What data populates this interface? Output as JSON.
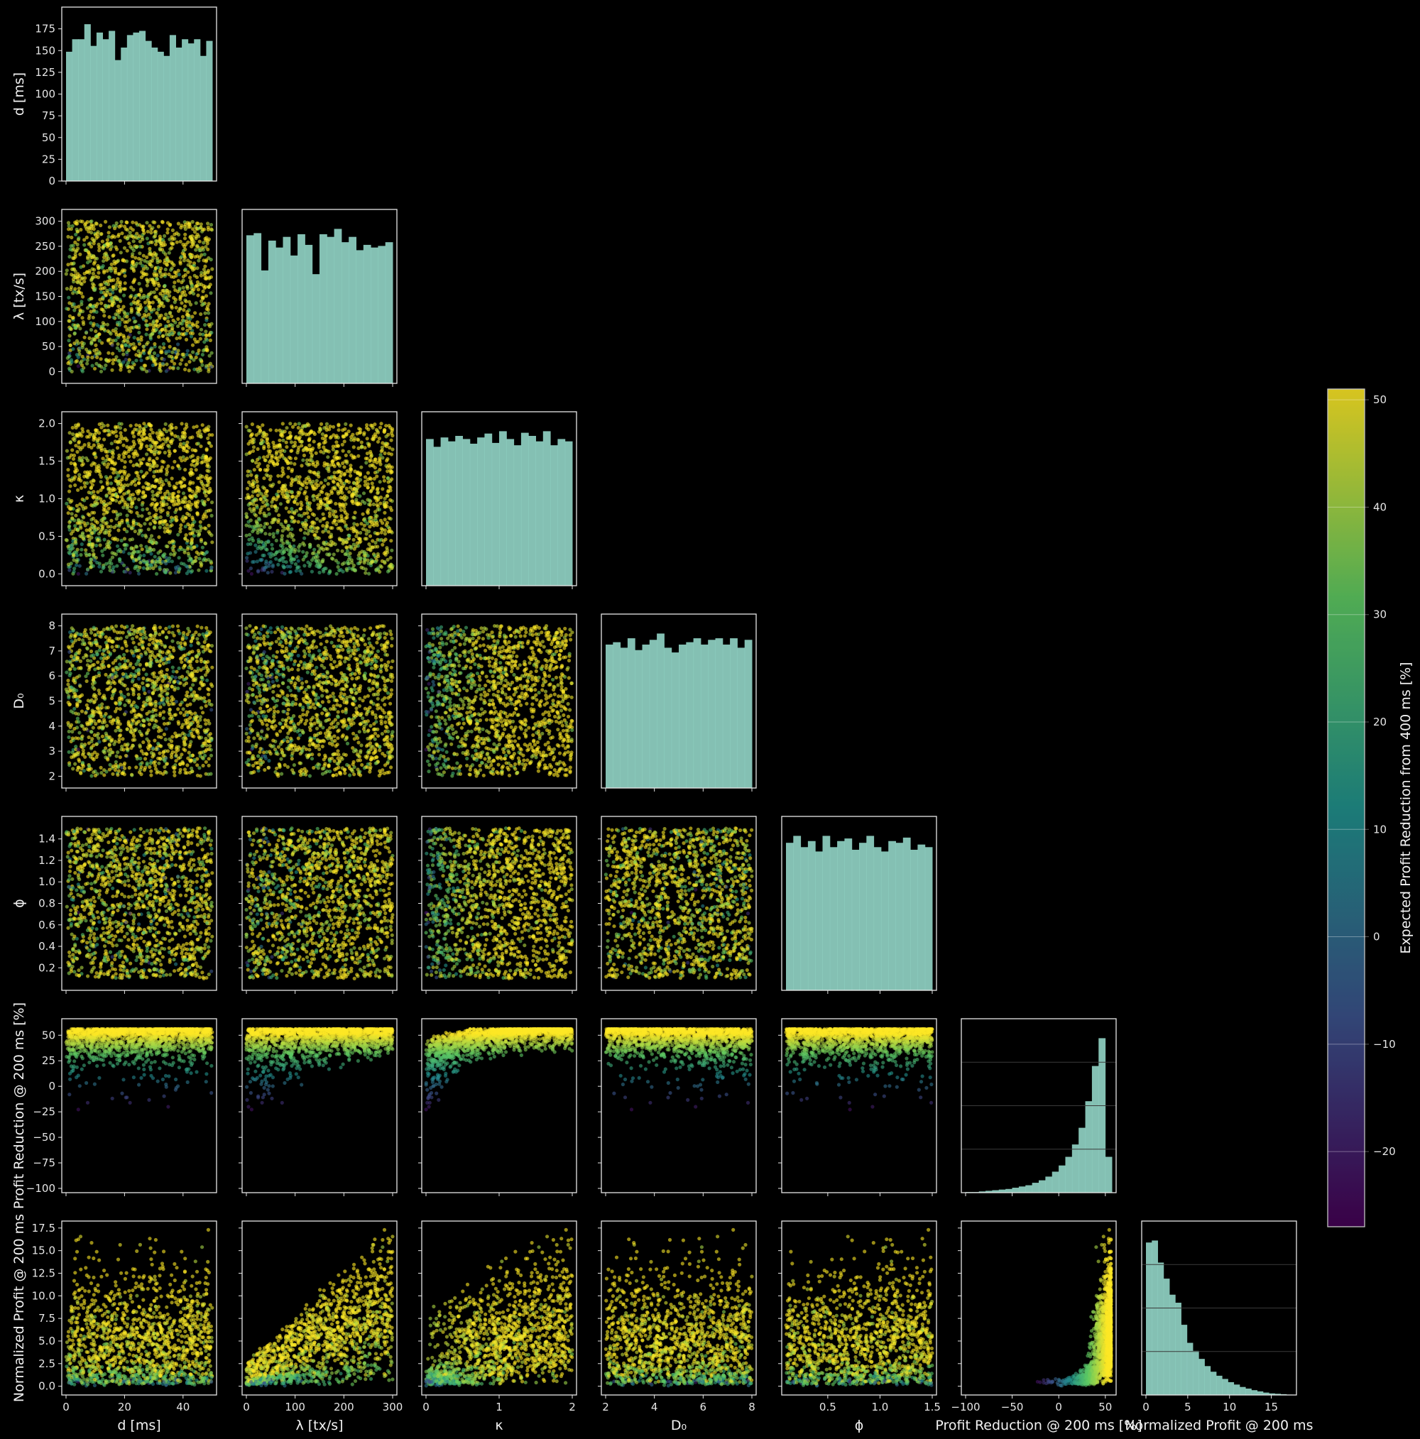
{
  "chart_data": {
    "type": "scatter",
    "variables": [
      {
        "key": "d",
        "label": "d [ms]",
        "range": [
          0,
          50
        ],
        "ylim": [
          0,
          50
        ],
        "ticks": [
          0,
          20,
          40
        ],
        "tick_labels": [
          "0",
          "20",
          "40"
        ]
      },
      {
        "key": "lambda",
        "label": "λ [tx/s]",
        "range": [
          0,
          300
        ],
        "ylim": [
          -15,
          315
        ],
        "ticks": [
          0,
          100,
          200,
          300
        ],
        "tick_labels": [
          "0",
          "100",
          "200",
          "300"
        ],
        "yticks": [
          0,
          50,
          100,
          150,
          200,
          250,
          300
        ],
        "ytick_labels": [
          "0",
          "50",
          "100",
          "150",
          "200",
          "250",
          "300"
        ]
      },
      {
        "key": "kappa",
        "label": "κ",
        "range": [
          0,
          2
        ],
        "ylim": [
          -0.1,
          2.1
        ],
        "ticks": [
          0,
          1,
          2
        ],
        "tick_labels": [
          "0",
          "1",
          "2"
        ],
        "yticks": [
          0,
          0.5,
          1,
          1.5,
          2
        ],
        "ytick_labels": [
          "0.0",
          "0.5",
          "1.0",
          "1.5",
          "2.0"
        ]
      },
      {
        "key": "D0",
        "label": "D₀",
        "range": [
          2,
          8
        ],
        "ylim": [
          1.7,
          8.3
        ],
        "ticks": [
          2,
          4,
          6,
          8
        ],
        "tick_labels": [
          "2",
          "4",
          "6",
          "8"
        ],
        "yticks": [
          2,
          3,
          4,
          5,
          6,
          7,
          8
        ],
        "ytick_labels": [
          "2",
          "3",
          "4",
          "5",
          "6",
          "7",
          "8"
        ]
      },
      {
        "key": "phi",
        "label": "ϕ",
        "range": [
          0.1,
          1.5
        ],
        "ylim": [
          0.03,
          1.57
        ],
        "ticks": [
          0.5,
          1.0,
          1.5
        ],
        "tick_labels": [
          "0.5",
          "1.0",
          "1.5"
        ],
        "yticks": [
          0.2,
          0.4,
          0.6,
          0.8,
          1.0,
          1.2,
          1.4
        ],
        "ytick_labels": [
          "0.2",
          "0.4",
          "0.6",
          "0.8",
          "1.0",
          "1.2",
          "1.4"
        ]
      },
      {
        "key": "pr",
        "label": "Profit Reduction @ 200 ms [%]",
        "range": [
          -100,
          57
        ],
        "ylim": [
          -100,
          62
        ],
        "ticks": [
          -100,
          -50,
          0,
          50
        ],
        "tick_labels": [
          "−100",
          "−50",
          "0",
          "50"
        ],
        "yticks": [
          -100,
          -75,
          -50,
          -25,
          0,
          25,
          50
        ],
        "ytick_labels": [
          "−100",
          "−75",
          "−50",
          "−25",
          "0",
          "25",
          "50"
        ]
      },
      {
        "key": "np",
        "label": "Normalized Profit @ 200 ms",
        "range": [
          0,
          17.5
        ],
        "ylim": [
          -0.5,
          17.8
        ],
        "ticks": [
          0,
          5,
          10,
          15
        ],
        "tick_labels": [
          "0",
          "5",
          "10",
          "15"
        ],
        "yticks": [
          0,
          2.5,
          5,
          7.5,
          10,
          12.5,
          15,
          17.5
        ],
        "ytick_labels": [
          "0.0",
          "2.5",
          "5.0",
          "7.5",
          "10.0",
          "12.5",
          "15.0",
          "17.5"
        ]
      }
    ],
    "first_hist_yaxis": {
      "ylim": [
        0,
        200
      ],
      "ticks": [
        0,
        25,
        50,
        75,
        100,
        125,
        150,
        175
      ],
      "tick_labels": [
        "0",
        "25",
        "50",
        "75",
        "100",
        "125",
        "150",
        "175"
      ]
    },
    "histograms": [
      [
        155,
        170,
        170,
        188,
        162,
        178,
        170,
        180,
        145,
        160,
        175,
        178,
        180,
        168,
        160,
        155,
        150,
        175,
        160,
        170,
        165,
        170,
        150,
        168
      ],
      [
        278,
        282,
        212,
        268,
        255,
        275,
        240,
        280,
        260,
        205,
        280,
        275,
        290,
        265,
        275,
        250,
        260,
        255,
        258,
        265
      ],
      [
        188,
        178,
        190,
        185,
        192,
        188,
        182,
        190,
        195,
        183,
        198,
        188,
        180,
        196,
        192,
        185,
        198,
        180,
        188,
        185
      ],
      [
        182,
        185,
        178,
        190,
        175,
        182,
        188,
        196,
        178,
        172,
        182,
        185,
        190,
        182,
        188,
        190,
        182,
        190,
        178,
        188
      ],
      [
        170,
        178,
        165,
        172,
        160,
        178,
        165,
        172,
        175,
        162,
        170,
        178,
        165,
        160,
        172,
        170,
        176,
        162,
        168,
        165
      ],
      [
        1,
        1,
        2,
        3,
        4,
        5,
        6,
        8,
        10,
        12,
        16,
        20,
        26,
        34,
        44,
        58,
        78,
        105,
        148,
        205,
        250,
        58
      ],
      [
        380,
        385,
        330,
        290,
        250,
        230,
        175,
        130,
        110,
        90,
        72,
        58,
        48,
        40,
        32,
        26,
        20,
        16,
        12,
        9,
        6,
        4,
        3,
        2,
        1
      ]
    ],
    "colorbar": {
      "label": "Expected Profit Reduction from 400 ms [%]",
      "range": [
        -27,
        51
      ],
      "ticks": [
        -20,
        -10,
        0,
        10,
        20,
        30,
        40,
        50
      ],
      "tick_labels": [
        "−20",
        "−10",
        "0",
        "10",
        "20",
        "30",
        "40",
        "50"
      ]
    },
    "colors": {
      "background": "#000000",
      "hist": "#8fd0c2",
      "axis": "#e6e6e6",
      "grid": "#3a3a3a",
      "viridis": [
        "#440154",
        "#3b528b",
        "#21918c",
        "#5ec962",
        "#fde725"
      ]
    }
  }
}
